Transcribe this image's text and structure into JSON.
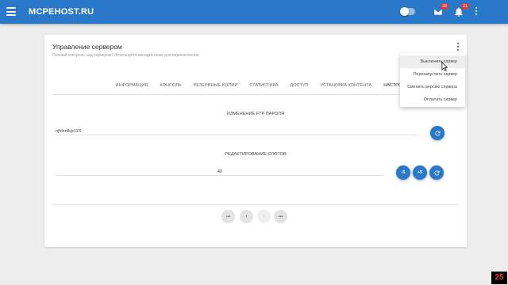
{
  "app": {
    "title": "MCPEHOST.RU"
  },
  "topbar": {
    "icons": {
      "menu": "menu-icon",
      "mail": "mail-icon",
      "bell": "bell-icon",
      "more": "more-vertical-icon"
    },
    "mail_badge": "28",
    "bell_badge": "21",
    "theme_toggle_on": false
  },
  "card": {
    "title": "Управление сервером",
    "subtitle": "Полный контроль над сервером! Используйте вкладки ниже для переключения."
  },
  "tabs": [
    "ИНФОРМАЦИЯ",
    "КОНСОЛЬ",
    "РЕЗЕРВНЫЕ КОПИИ",
    "СТАТИСТИКА",
    "ДОСТУП",
    "УСТАНОВКА КОНТЕНТА",
    "НАСТРОЙКИ"
  ],
  "active_tab": "НАСТРОЙКИ",
  "ftp": {
    "title": "ИЗМЕНЕНИЕ FTP ПАРОЛЯ",
    "password": "njfdsnfkjs123",
    "refresh_icon": "refresh-icon"
  },
  "slots": {
    "title": "РЕДАКТИРОВАНИЕ СЛОТОВ",
    "value": "40",
    "minus_label": "-5",
    "plus_label": "+5",
    "refresh_icon": "refresh-icon"
  },
  "pagination": {
    "first": "•••",
    "prev": "‹",
    "next": "›",
    "last": "•••"
  },
  "dropdown": {
    "items": [
      "Выключить сервер",
      "Перезапустить сервер",
      "Сменить версию сервера",
      "Оплатить сервер"
    ],
    "hovered_index": 0
  },
  "watermark": "25",
  "colors": {
    "primary": "#2a78c9",
    "background": "#ededed",
    "badge": "#e53935"
  }
}
